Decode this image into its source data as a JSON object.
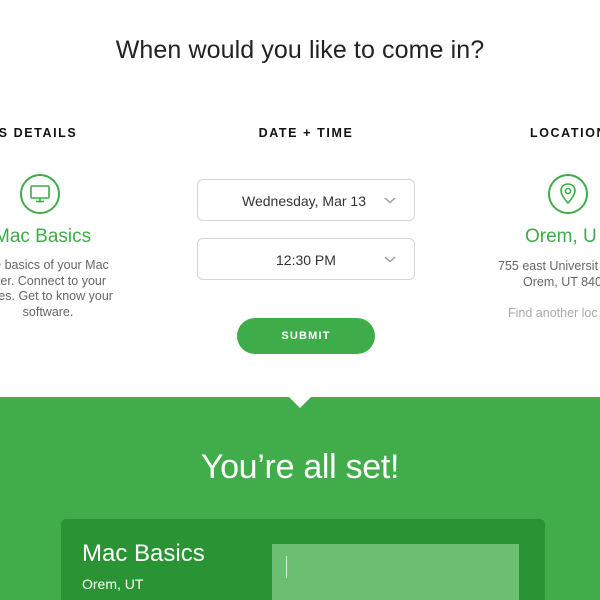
{
  "heading": "When would you like to come in?",
  "columns": {
    "class_details": {
      "title": "ASS DETAILS",
      "icon": "monitor-icon",
      "name": "Mac Basics",
      "description": [
        "he basics of your Mac",
        "uter. Connect to your",
        "vices. Get to know your",
        "software."
      ]
    },
    "date_time": {
      "title": "DATE + TIME",
      "date_value": "Wednesday, Mar 13",
      "time_value": "12:30 PM",
      "submit_label": "SUBMIT"
    },
    "location": {
      "title": "LOCATION",
      "icon": "location-pin-icon",
      "name": "Orem, U",
      "address_line1": "755 east Universit",
      "address_line2": "Orem, UT 840",
      "find_link": "Find another loc"
    }
  },
  "confirmation": {
    "title": "You’re all set!",
    "card_title": "Mac Basics",
    "card_location": "Orem, UT"
  },
  "colors": {
    "accent": "#3eac48",
    "band": "#40ad4a",
    "card": "#2a9434"
  }
}
